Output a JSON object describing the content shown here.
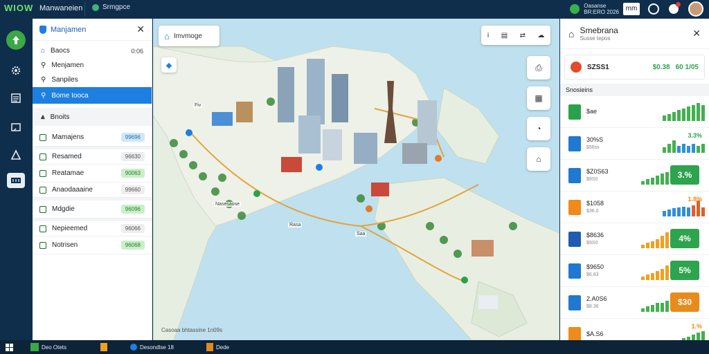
{
  "app": {
    "brand": "WIOW",
    "title": "Manwaneien",
    "chip": "Srmgpce"
  },
  "topbar_right": {
    "line1": "Oasanse",
    "line2": "BR:ERO 2026",
    "box": "mm"
  },
  "left_panel": {
    "title": "Manjamen",
    "rows": [
      {
        "label": "Baocs",
        "value": "0:06"
      },
      {
        "label": "Menjamen",
        "value": ""
      },
      {
        "label": "Sanpiles",
        "value": ""
      },
      {
        "label": "Bome tooca",
        "value": ""
      }
    ],
    "section": "Bnoits",
    "cards": [
      {
        "label": "Mamajens",
        "badge": "99696",
        "badge_color": "#cfe8f7",
        "badge_text": "#1d6fb0"
      },
      {
        "label": "Resamed",
        "badge": "96630",
        "badge_color": "#eeeeee",
        "badge_text": "#555"
      },
      {
        "label": "Reatamae",
        "badge": "90063",
        "badge_color": "#c9f0c9",
        "badge_text": "#267a26"
      },
      {
        "label": "Anaodaaaine",
        "badge": "99660",
        "badge_color": "#eeeeee",
        "badge_text": "#555"
      },
      {
        "label": "Mdgdie",
        "badge": "96096",
        "badge_color": "#c9f0c9",
        "badge_text": "#267a26"
      },
      {
        "label": "Nepieemed",
        "badge": "96066",
        "badge_color": "#eeeeee",
        "badge_text": "#555"
      },
      {
        "label": "Notrisen",
        "badge": "96068",
        "badge_color": "#c9f0c9",
        "badge_text": "#267a26"
      }
    ]
  },
  "map": {
    "search_label": "Imvmoge",
    "pins": [
      {
        "label": "Fiv"
      },
      {
        "label": "Nasesaose"
      },
      {
        "label": "Rasa"
      },
      {
        "label": "Saa"
      }
    ],
    "attribution": "Casoaa bhtassine 1n09s"
  },
  "right_panel": {
    "title": "Smebrana",
    "subtitle": "Susse tepos",
    "summary": {
      "label": "SZSS1",
      "value1": "$0.38",
      "value2": "60 1/05"
    },
    "section": "Snosieins",
    "rows": [
      {
        "label": "$ae",
        "sub": "",
        "pct": "",
        "pct_color": "#2ea44f",
        "big": false,
        "icon_color": "#2aa24a",
        "bars": [
          {
            "v": 0.3,
            "c": "#43b14f"
          },
          {
            "v": 0.4,
            "c": "#43b14f"
          },
          {
            "v": 0.5,
            "c": "#43b14f"
          },
          {
            "v": 0.6,
            "c": "#43b14f"
          },
          {
            "v": 0.7,
            "c": "#43b14f"
          },
          {
            "v": 0.8,
            "c": "#43b14f"
          },
          {
            "v": 0.9,
            "c": "#43b14f"
          },
          {
            "v": 1.0,
            "c": "#43b14f"
          },
          {
            "v": 0.9,
            "c": "#43b14f"
          }
        ]
      },
      {
        "label": "30%S",
        "sub": "$56ss",
        "pct": "3.3%",
        "pct_color": "#2ea44f",
        "big": false,
        "icon_color": "#1f78d1",
        "bars": [
          {
            "v": 0.3,
            "c": "#43b14f"
          },
          {
            "v": 0.5,
            "c": "#43b14f"
          },
          {
            "v": 0.7,
            "c": "#43b14f"
          },
          {
            "v": 0.4,
            "c": "#2f8fd8"
          },
          {
            "v": 0.5,
            "c": "#2f8fd8"
          },
          {
            "v": 0.4,
            "c": "#2f8fd8"
          },
          {
            "v": 0.5,
            "c": "#2f8fd8"
          },
          {
            "v": 0.4,
            "c": "#43b14f"
          },
          {
            "v": 0.5,
            "c": "#43b14f"
          }
        ]
      },
      {
        "label": "$Z0S63",
        "sub": "$9S0",
        "pct": "3.%",
        "pct_color": "#2ea44f",
        "big": true,
        "icon_color": "#1f78d1",
        "bars": [
          {
            "v": 0.2,
            "c": "#43b14f"
          },
          {
            "v": 0.3,
            "c": "#43b14f"
          },
          {
            "v": 0.4,
            "c": "#43b14f"
          },
          {
            "v": 0.5,
            "c": "#43b14f"
          },
          {
            "v": 0.6,
            "c": "#43b14f"
          },
          {
            "v": 0.7,
            "c": "#43b14f"
          }
        ]
      },
      {
        "label": "$1058",
        "sub": "$36.0",
        "pct": "1.8%",
        "pct_color": "#e98b1c",
        "big": false,
        "icon_color": "#f08a1a",
        "bars": [
          {
            "v": 0.3,
            "c": "#2f8fd8"
          },
          {
            "v": 0.4,
            "c": "#2f8fd8"
          },
          {
            "v": 0.45,
            "c": "#2f8fd8"
          },
          {
            "v": 0.5,
            "c": "#2f8fd8"
          },
          {
            "v": 0.55,
            "c": "#2f8fd8"
          },
          {
            "v": 0.5,
            "c": "#2f8fd8"
          },
          {
            "v": 0.6,
            "c": "#e0602a"
          },
          {
            "v": 0.9,
            "c": "#e0602a"
          },
          {
            "v": 0.5,
            "c": "#e0602a"
          }
        ]
      },
      {
        "label": "$8636",
        "sub": "$9S0",
        "pct": "4%",
        "pct_color": "#2ea44f",
        "big": true,
        "icon_color": "#1f5bb3",
        "bars": [
          {
            "v": 0.2,
            "c": "#f0a020"
          },
          {
            "v": 0.3,
            "c": "#f0a020"
          },
          {
            "v": 0.4,
            "c": "#f0a020"
          },
          {
            "v": 0.5,
            "c": "#f0a020"
          },
          {
            "v": 0.7,
            "c": "#f0a020"
          },
          {
            "v": 0.9,
            "c": "#f0a020"
          }
        ]
      },
      {
        "label": "$9650",
        "sub": "$6.83",
        "pct": "5%",
        "pct_color": "#2ea44f",
        "big": true,
        "icon_color": "#1f78d1",
        "bars": [
          {
            "v": 0.2,
            "c": "#f0a020"
          },
          {
            "v": 0.3,
            "c": "#f0a020"
          },
          {
            "v": 0.4,
            "c": "#f0a020"
          },
          {
            "v": 0.5,
            "c": "#f0a020"
          },
          {
            "v": 0.6,
            "c": "#f0a020"
          },
          {
            "v": 0.8,
            "c": "#f0a020"
          }
        ]
      },
      {
        "label": "2.A0S6",
        "sub": "$8.36",
        "pct": "$30",
        "pct_color": "#e98b1c",
        "big": true,
        "icon_color": "#1f78d1",
        "bars": [
          {
            "v": 0.2,
            "c": "#43b14f"
          },
          {
            "v": 0.3,
            "c": "#43b14f"
          },
          {
            "v": 0.4,
            "c": "#43b14f"
          },
          {
            "v": 0.5,
            "c": "#43b14f"
          },
          {
            "v": 0.5,
            "c": "#43b14f"
          },
          {
            "v": 0.6,
            "c": "#43b14f"
          }
        ]
      },
      {
        "label": "$A.S6",
        "sub": "",
        "pct": "1.%",
        "pct_color": "#e98b1c",
        "big": false,
        "icon_color": "#f08a1a",
        "bars": [
          {
            "v": 0.2,
            "c": "#43b14f"
          },
          {
            "v": 0.3,
            "c": "#43b14f"
          },
          {
            "v": 0.4,
            "c": "#43b14f"
          },
          {
            "v": 0.5,
            "c": "#43b14f"
          },
          {
            "v": 0.6,
            "c": "#43b14f"
          },
          {
            "v": 0.7,
            "c": "#43b14f"
          }
        ]
      }
    ]
  },
  "taskbar": {
    "items": [
      "Deo Otets",
      "Desondlse 18",
      "Dede"
    ]
  },
  "colors": {
    "accent": "#1d7fe0",
    "dark": "#0f2e4b",
    "green": "#43b14f"
  }
}
